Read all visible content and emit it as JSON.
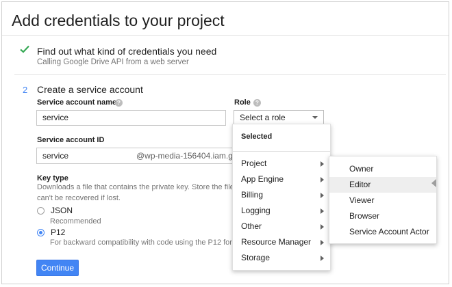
{
  "page": {
    "title": "Add credentials to your project"
  },
  "step1": {
    "icon": "check-icon",
    "title": "Find out what kind of credentials you need",
    "subtitle": "Calling Google Drive API from a web server"
  },
  "step2": {
    "number": "2",
    "title": "Create a service account",
    "service_account_name": {
      "label": "Service account name",
      "value": "service"
    },
    "role": {
      "label": "Role",
      "selected": "Select a role"
    },
    "service_account_id": {
      "label": "Service account ID",
      "value": "service",
      "suffix": "@wp-media-156404.iam.gs"
    },
    "key_type": {
      "label": "Key type",
      "description_line1": "Downloads a file that contains the private key. Store the file se",
      "description_line2": "can't be recovered if lost.",
      "options": [
        {
          "label": "JSON",
          "description": "Recommended",
          "checked": false
        },
        {
          "label": "P12",
          "description": "For backward compatibility with code using the P12 forma",
          "checked": true
        }
      ]
    },
    "continue_label": "Continue"
  },
  "role_menu": {
    "header": "Selected",
    "items": [
      {
        "label": "Project",
        "has_submenu": true
      },
      {
        "label": "App Engine",
        "has_submenu": true
      },
      {
        "label": "Billing",
        "has_submenu": true
      },
      {
        "label": "Logging",
        "has_submenu": true
      },
      {
        "label": "Other",
        "has_submenu": true
      },
      {
        "label": "Resource Manager",
        "has_submenu": true
      },
      {
        "label": "Storage",
        "has_submenu": true
      }
    ]
  },
  "project_submenu": {
    "items": [
      {
        "label": "Owner"
      },
      {
        "label": "Editor",
        "highlighted": true
      },
      {
        "label": "Viewer"
      },
      {
        "label": "Browser"
      },
      {
        "label": "Service Account Actor"
      }
    ]
  },
  "colors": {
    "accent": "#4285f4",
    "check": "#34a853",
    "hover": "#eeeeee"
  }
}
